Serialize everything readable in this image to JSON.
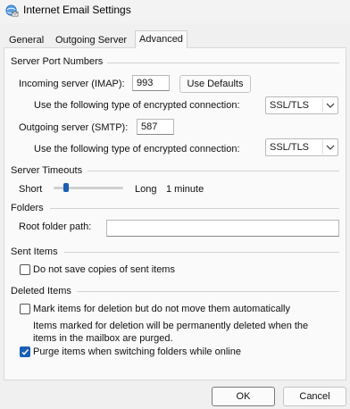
{
  "window": {
    "title": "Internet Email Settings",
    "icon": "globe-mail-icon"
  },
  "tabs": [
    {
      "label": "General",
      "active": false
    },
    {
      "label": "Outgoing Server",
      "active": false
    },
    {
      "label": "Advanced",
      "active": true
    }
  ],
  "server_ports": {
    "heading": "Server Port Numbers",
    "incoming_label": "Incoming server (IMAP):",
    "incoming_value": "993",
    "use_defaults": "Use Defaults",
    "encryption_label_1": "Use the following type of encrypted connection:",
    "encryption_value_1": "SSL/TLS",
    "outgoing_label": "Outgoing server (SMTP):",
    "outgoing_value": "587",
    "encryption_label_2": "Use the following type of encrypted connection:",
    "encryption_value_2": "SSL/TLS"
  },
  "timeouts": {
    "heading": "Server Timeouts",
    "short_label": "Short",
    "long_label": "Long",
    "value": "1 minute",
    "level": 0.15
  },
  "folders": {
    "heading": "Folders",
    "root_label": "Root folder path:",
    "root_value": ""
  },
  "sent_items": {
    "heading": "Sent Items",
    "no_copies_label": "Do not save copies of sent items",
    "no_copies_checked": false
  },
  "deleted_items": {
    "heading": "Deleted Items",
    "mark_label": "Mark items for deletion but do not move them automatically",
    "mark_checked": false,
    "note_line1": "Items marked for deletion will be permanently deleted when the",
    "note_line2": "items in the mailbox are purged.",
    "purge_label": "Purge items when switching folders while online",
    "purge_checked": true
  },
  "footer": {
    "ok": "OK",
    "cancel": "Cancel"
  },
  "colors": {
    "accent": "#1a5fb4",
    "panel": "#fafafa",
    "window": "#f0f0f0"
  }
}
